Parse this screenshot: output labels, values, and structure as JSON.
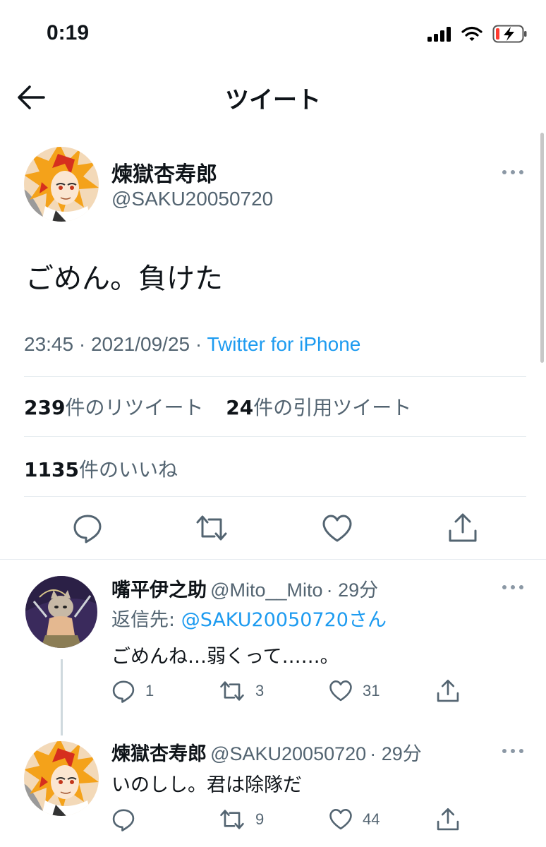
{
  "status_bar": {
    "time": "0:19"
  },
  "nav": {
    "title": "ツイート"
  },
  "main_tweet": {
    "author_name": "煉獄杏寿郎",
    "author_handle": "@SAKU20050720",
    "text": "ごめん。負けた",
    "time": "23:45 · 2021/09/25 · ",
    "client": "Twitter for iPhone",
    "retweets_count": "239",
    "retweets_label": "件のリツイート",
    "quotes_count": "24",
    "quotes_label": "件の引用ツイート",
    "likes_count": "1135",
    "likes_label": "件のいいね"
  },
  "replies": [
    {
      "author_name": "嘴平伊之助",
      "author_handle": "@Mito__Mito",
      "time": "· 29分",
      "reply_to_label": "返信先: ",
      "reply_to_mention": "@SAKU20050720さん",
      "text": "ごめんね…弱くって……。",
      "reply_count": "1",
      "retweet_count": "3",
      "like_count": "31"
    },
    {
      "author_name": "煉獄杏寿郎",
      "author_handle": "@SAKU20050720",
      "time": "· 29分",
      "text": "いのしし。君は除隊だ",
      "reply_count": "",
      "retweet_count": "9",
      "like_count": "44"
    }
  ],
  "colors": {
    "link": "#1d9bf0",
    "secondary_text": "#536471",
    "divider": "#e6ecf0"
  }
}
